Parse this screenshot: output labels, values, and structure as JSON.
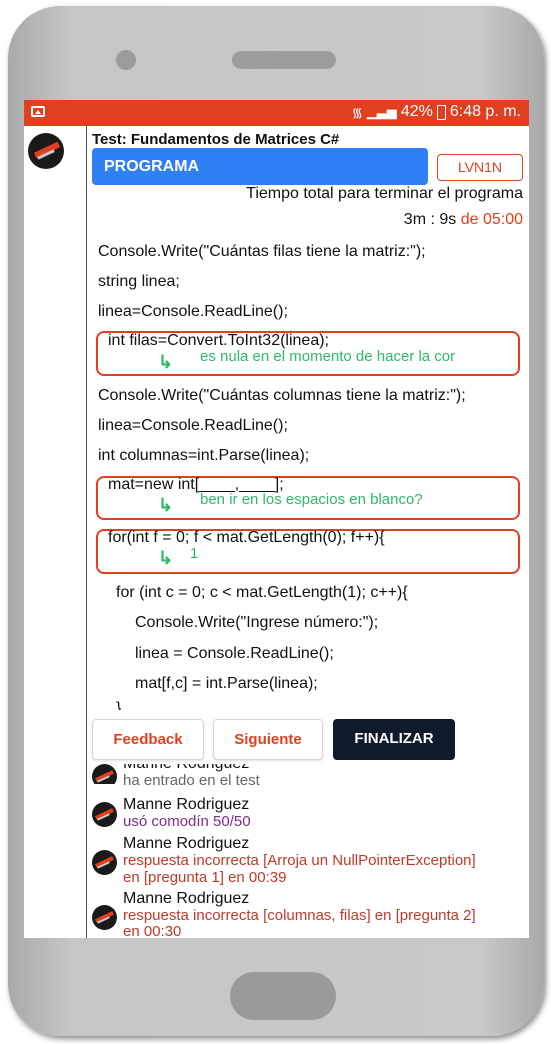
{
  "statusbar": {
    "right_icons": "wifi-icon signal-icon",
    "battery": "42%",
    "time": "6:48 p. m."
  },
  "test": {
    "title": "Test: Fundamentos de Matrices C#",
    "section_button": "PROGRAMA",
    "level_button": "LVN1N",
    "time_label": "Tiempo total para terminar el programa",
    "time_elapsed": "3m : 9s",
    "time_limit": "de 05:00"
  },
  "code": {
    "line1": "Console.Write(\"Cuántas filas tiene la matriz:\");",
    "line2": "string linea;",
    "line3": "linea=Console.ReadLine();",
    "line4": "int filas=Convert.ToInt32(linea);",
    "hint1": "es nula en el momento de hacer la cor",
    "line5": "Console.Write(\"Cuántas columnas tiene la matriz:\");",
    "line6": "linea=Console.ReadLine();",
    "line7": "int columnas=int.Parse(linea);",
    "line8": "mat=new int[____,____];",
    "hint2": "ben ir en los espacios en blanco?",
    "line9": "for(int f = 0; f < mat.GetLength(0); f++){",
    "hint3": "1",
    "line10": "for (int c = 0; c < mat.GetLength(1); c++){",
    "line11": "Console.Write(\"Ingrese número:\");",
    "line12": "linea = Console.ReadLine();",
    "line13": "mat[f,c] = int.Parse(linea);",
    "line14": "}"
  },
  "actions": {
    "feedback": "Feedback",
    "next": "Siguiente",
    "finish": "FINALIZAR"
  },
  "log": [
    {
      "name": "Manne Rodriguez",
      "msg": "ha entrado en el test"
    },
    {
      "name": "Manne Rodriguez",
      "msg": "usó comodín 50/50"
    },
    {
      "name": "Manne Rodriguez",
      "msg": "respuesta incorrecta [Arroja un NullPointerException]",
      "msg2": "en [pregunta 1] en 00:39"
    },
    {
      "name": "Manne Rodriguez",
      "msg": "respuesta incorrecta [columnas, filas] en [pregunta 2]",
      "msg2": "en 00:30"
    }
  ],
  "colors": {
    "accent": "#e0401f",
    "primary_button": "#2f7ff5",
    "hint": "#2fb86a",
    "dark_button": "#0f1a2a"
  }
}
